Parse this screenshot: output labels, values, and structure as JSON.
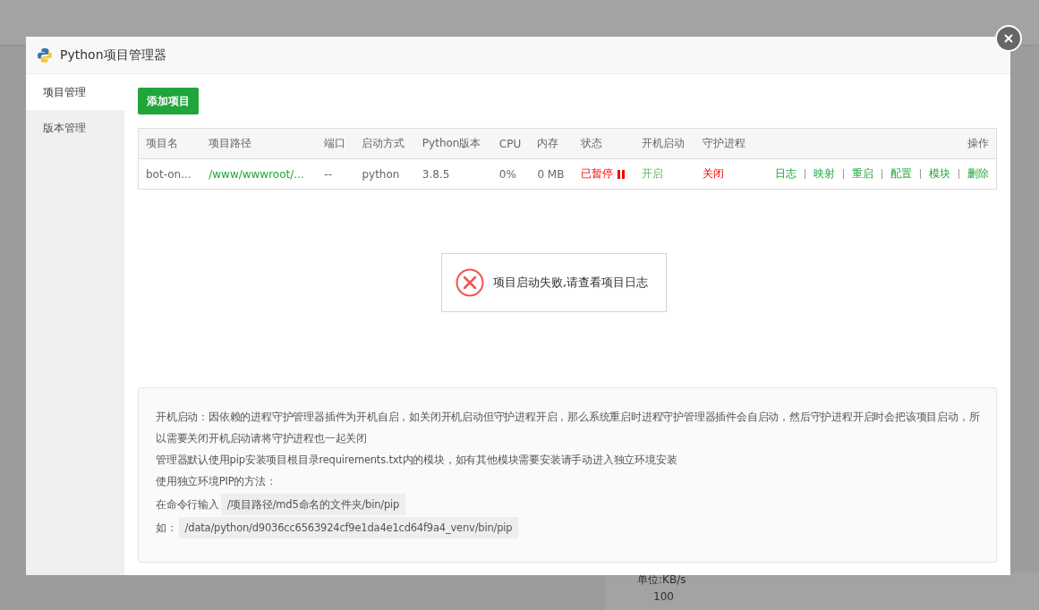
{
  "background": {
    "unit_label": "单位:KB/s",
    "axis_value": "100"
  },
  "window": {
    "title": "Python项目管理器"
  },
  "sidebar": {
    "items": [
      {
        "label": "项目管理",
        "selected": true
      },
      {
        "label": "版本管理",
        "selected": false
      }
    ]
  },
  "add_button": "添加项目",
  "table": {
    "columns": [
      "项目名",
      "项目路径",
      "端口",
      "启动方式",
      "Python版本",
      "CPU",
      "内存",
      "状态",
      "开机启动",
      "守护进程",
      "操作"
    ],
    "rows": [
      {
        "name": "bot-on...",
        "path": "/www/wwwroot/...",
        "port": "--",
        "start_mode": "python",
        "python_version": "3.8.5",
        "cpu": "0%",
        "memory": "0 MB",
        "status": {
          "text": "已暂停",
          "running": false
        },
        "autostart": {
          "text": "开启",
          "on": true
        },
        "daemon": {
          "text": "关闭",
          "on": false
        },
        "actions": [
          "日志",
          "映射",
          "重启",
          "配置",
          "模块",
          "删除"
        ]
      }
    ]
  },
  "toast": {
    "kind": "error",
    "message": "项目启动失败,请查看项目日志"
  },
  "notes": [
    {
      "kind": "text",
      "text": "开机启动：因依赖的进程守护管理器插件为开机自启，如关闭开机启动但守护进程开启，那么系统重启时进程守护管理器插件会自启动，然后守护进程开启时会把该项目启动，所以需要关闭开机启动请将守护进程也一起关闭"
    },
    {
      "kind": "text",
      "text": "管理器默认使用pip安装项目根目录requirements.txt内的模块，如有其他模块需要安装请手动进入独立环境安装"
    },
    {
      "kind": "text",
      "text": "使用独立环境PIP的方法："
    },
    {
      "kind": "code",
      "text": "在命令行输入",
      "code": "/项目路径/md5命名的文件夹/bin/pip"
    },
    {
      "kind": "code",
      "text": "如：",
      "code": "/data/python/d9036cc6563924cf9e1da4e1cd64f9a4_venv/bin/pip"
    }
  ]
}
